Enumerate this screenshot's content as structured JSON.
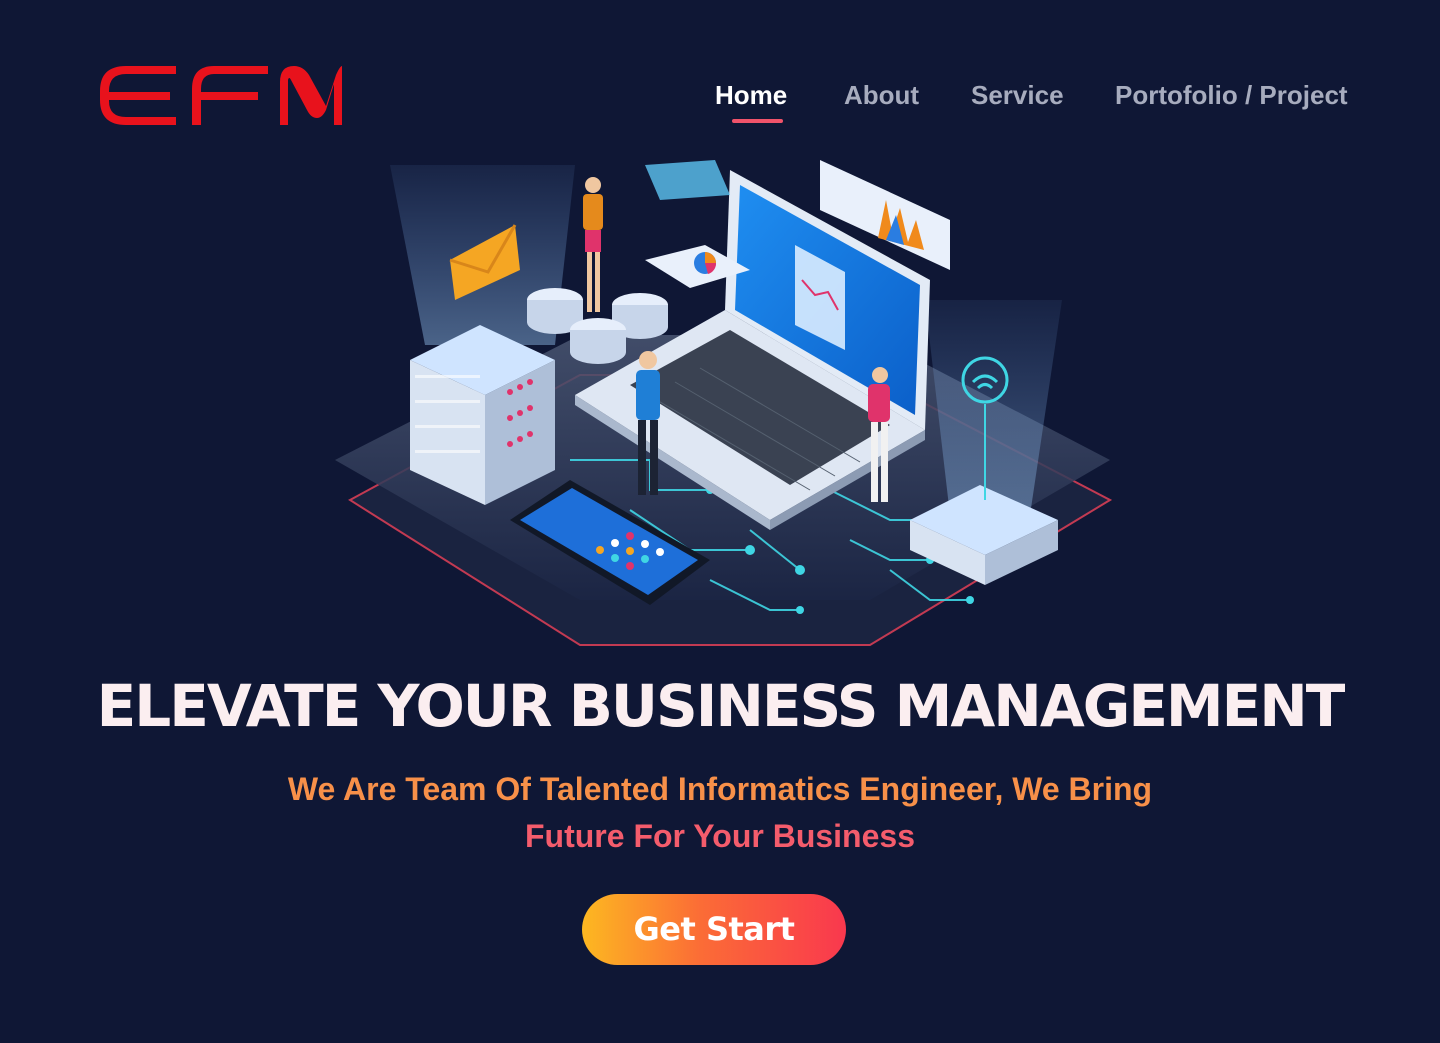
{
  "brand": {
    "logo_text": "EFM",
    "color": "#e8121c"
  },
  "nav": {
    "items": [
      {
        "label": "Home",
        "active": true
      },
      {
        "label": "About",
        "active": false
      },
      {
        "label": "Service",
        "active": false
      },
      {
        "label": "Portofolio / Project",
        "active": false
      }
    ]
  },
  "hero": {
    "illustration": "isometric-tech-workspace-illustration",
    "headline": "ELEVATE YOUR BUSINESS MANAGEMENT",
    "subtitle_line1": "We Are Team Of Talented Informatics Engineer, We Bring",
    "subtitle_line2": "Future For Your Business",
    "cta_label": "Get Start"
  },
  "colors": {
    "background": "#0f1735",
    "accent": "#f0536a",
    "subtitle_orange": "#f79049",
    "subtitle_pink": "#f45c6c",
    "cta_gradient_start": "#fdb821",
    "cta_gradient_end": "#f9384e"
  }
}
